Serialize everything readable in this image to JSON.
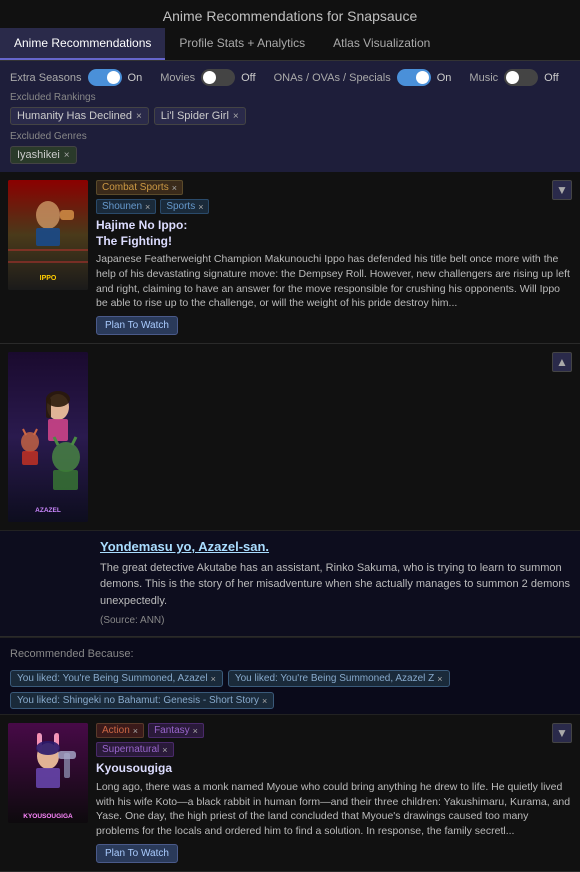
{
  "page": {
    "title": "Anime Recommendations for Snapsauce"
  },
  "tabs": [
    {
      "id": "recommendations",
      "label": "Anime Recommendations",
      "active": true
    },
    {
      "id": "profile-stats",
      "label": "Profile Stats + Analytics",
      "active": false
    },
    {
      "id": "atlas",
      "label": "Atlas Visualization",
      "active": false
    }
  ],
  "controls": {
    "label": "Extra Seasons",
    "toggles": [
      {
        "id": "extra-seasons",
        "label": "Extra Seasons",
        "state": "On",
        "on": true
      },
      {
        "id": "movies",
        "label": "Movies",
        "state": "Off",
        "on": false
      },
      {
        "id": "ovas",
        "label": "ONAs / OVAs / Specials",
        "state": "On",
        "on": true
      },
      {
        "id": "music",
        "label": "Music",
        "state": "Off",
        "on": false
      }
    ]
  },
  "excluded_rankings": {
    "label": "Excluded Rankings",
    "tags": [
      {
        "text": "Humanity Has Declined"
      },
      {
        "text": "Li'l Spider Girl"
      }
    ]
  },
  "excluded_genres": {
    "label": "Excluded Genres",
    "tags": [
      {
        "text": "Iyashikei"
      }
    ]
  },
  "anime": [
    {
      "id": "ippo",
      "title": "Hajime No Ippo:\nThe Fighting!",
      "tags": [
        {
          "label": "Combat Sports",
          "type": "combat"
        },
        {
          "label": "Shounen",
          "type": "shounen"
        },
        {
          "label": "Sports",
          "type": "sports"
        }
      ],
      "description": "Japanese Featherweight Champion Makunouchi Ippo has defended his title belt once more with the help of his devastating signature move: the Dempsey Roll. However, new challengers are rising up left and right, claiming to have an answer for the move responsible for crushing his opponents. Will Ippo be able to rise up to the challenge, or will the weight of his pride destroy him...",
      "plan_btn": "Plan To Watch",
      "expanded": false,
      "collapse_btn": "▼"
    },
    {
      "id": "azazel",
      "title": "Yondemasu yo, Azazel-san.",
      "tags": [],
      "description": "The great detective Akutabe has an assistant, Rinko Sakuma, who is trying to learn to summon demons. This is the story of her misadventure when she actually manages to summon 2 demons unexpectedly.",
      "source": "(Source: ANN)",
      "plan_btn": null,
      "expanded": true,
      "collapse_btn": "▲"
    },
    {
      "id": "kyou",
      "title": "Kyousougiga",
      "tags": [
        {
          "label": "Action",
          "type": "action"
        },
        {
          "label": "Fantasy",
          "type": "fantasy"
        },
        {
          "label": "Supernatural",
          "type": "supernatural"
        }
      ],
      "description": "Long ago, there was a monk named Myoue who could bring anything he drew to life. He quietly lived with his wife Koto—a black rabbit in human form—and their three children: Yakushimaru, Kurama, and Yase. One day, the high priest of the land concluded that Myoue's drawings caused too many problems for the locals and ordered him to find a solution. In response, the family secretl...",
      "plan_btn": "Plan To Watch",
      "expanded": false
    }
  ],
  "recommended_because": {
    "label": "Recommended Because:",
    "tags_row1": [
      {
        "text": "You liked: You're Being Summoned, Azazel"
      },
      {
        "text": "You liked: You're Being Summoned, Azazel Z"
      }
    ],
    "tags_row2": [
      {
        "text": "You liked: Shingeki no Bahamut: Genesis - Short Story"
      }
    ]
  }
}
